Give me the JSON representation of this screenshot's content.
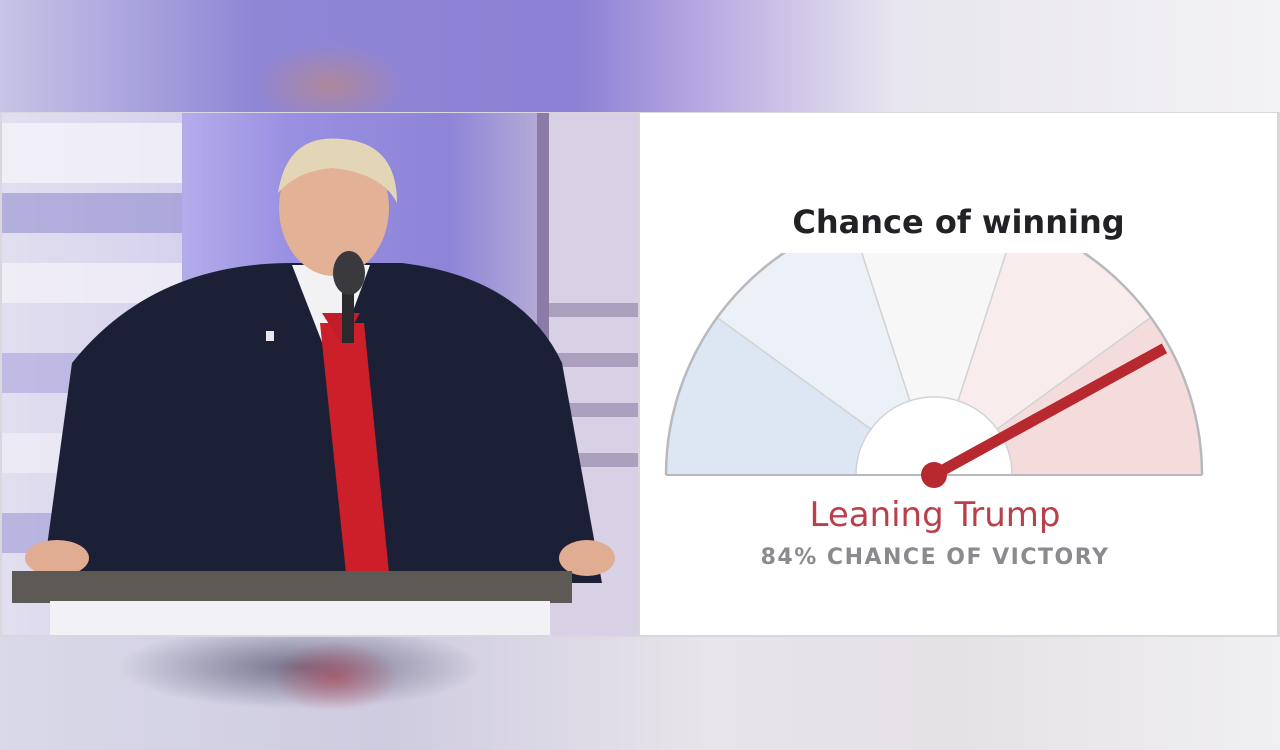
{
  "chart_data": {
    "type": "gauge",
    "title": "Chance of winning",
    "value": 84,
    "value_unit": "%",
    "range": [
      0,
      100
    ],
    "bands": 5,
    "band_colors": [
      "#dce7f3",
      "#ecf1f7",
      "#f7f7f8",
      "#f8ecec",
      "#f4dcdd"
    ],
    "needle_color": "#b8282f",
    "label": "Leaning Trump",
    "sublabel": "84% CHANCE OF VICTORY"
  },
  "colors": {
    "title": "#222226",
    "label": "#b9404a",
    "sublabel": "#8b8b8f"
  }
}
